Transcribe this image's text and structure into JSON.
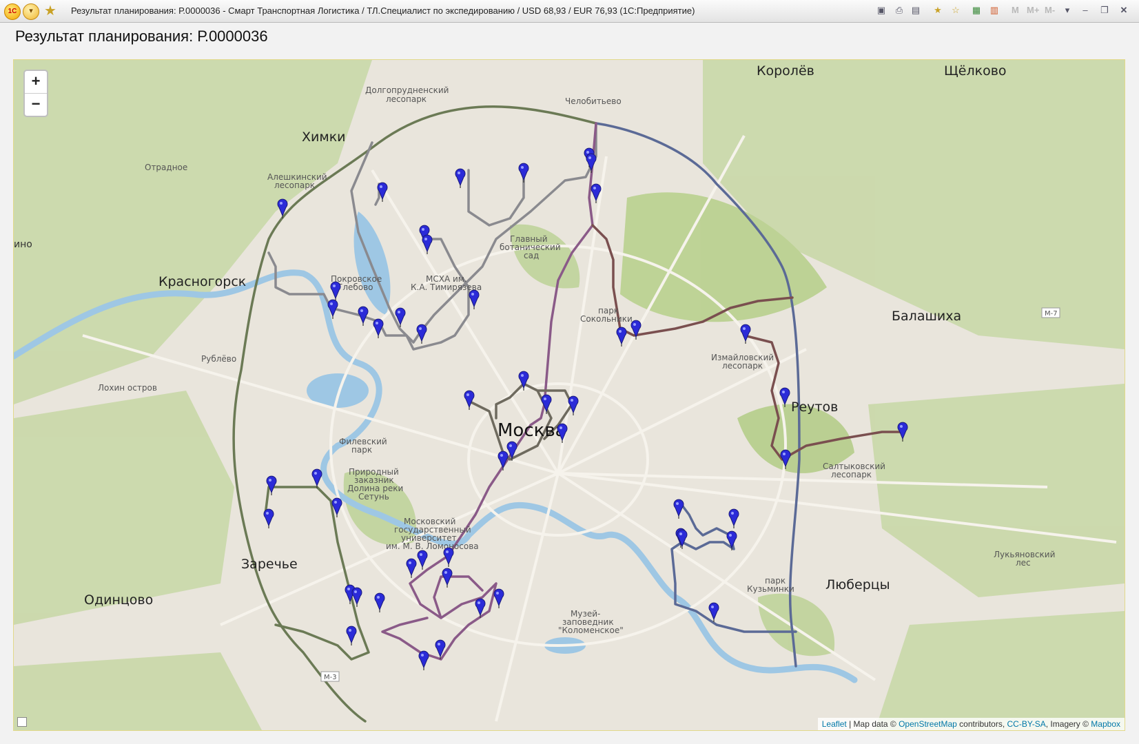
{
  "window": {
    "title": "Результат планирования: Р.0000036 - Смарт Транспортная Логистика / ТЛ.Специалист по экспедированию / USD 68,93 / EUR 76,93  (1С:Предприятие)",
    "logo_text": "1С",
    "toolbar_letters": [
      "M",
      "M+",
      "M-"
    ]
  },
  "page": {
    "title": "Результат планирования: Р.0000036"
  },
  "map": {
    "zoom_in_label": "+",
    "zoom_out_label": "−",
    "attribution": {
      "leaflet": "Leaflet",
      "map_data_prefix": " | Map data © ",
      "osm": "OpenStreetMap",
      "contributors": " contributors, ",
      "license": "CC-BY-SA",
      "imagery_prefix": ", Imagery © ",
      "mapbox": "Mapbox"
    },
    "labels": {
      "korolev": "Королёв",
      "shchelkovo": "Щёлково",
      "chelobitevo": "Челобитьево",
      "dolgoprudny1": "Долгопрудненский",
      "dolgoprudny2": "лесопарк",
      "khimki": "Химки",
      "otradnoe": "Отрадное",
      "aleshkinsky1": "Алешкинский",
      "aleshkinsky2": "лесопарк",
      "imino": "ино",
      "botsad1": "Главный",
      "botsad2": "ботанический",
      "botsad3": "сад",
      "krasnogorsk": "Красногорск",
      "pokrovskoe1": "Покровское",
      "pokrovskoe2": "Глебово",
      "mskha1": "МСХА им.",
      "mskha2": "К.А. Тимирязева",
      "sokolniki1": "парк",
      "sokolniki2": "Сокольники",
      "balashikha": "Балашиха",
      "m7": "М-7",
      "rublevo": "Рублёво",
      "izmaylovo1": "Измайловский",
      "izmaylovo2": "лесопарк",
      "lokhin": "Лохин остров",
      "reutov": "Реутов",
      "moskva": "Москва",
      "filevsky1": "Филевский",
      "filevsky2": "парк",
      "saltykovsky1": "Салтыковский",
      "saltykovsky2": "лесопарк",
      "setun1": "Природный",
      "setun2": "заказник",
      "setun3": "Долина реки",
      "setun4": "Сетунь",
      "mgu1": "Московский",
      "mgu2": "государственный",
      "mgu3": "университет",
      "mgu4": "им. М. В. Ломоносова",
      "lukyanovsky1": "Лукьяновский",
      "lukyanovsky2": "лес",
      "zarechye": "Заречье",
      "kuzminki1": "парк",
      "kuzminki2": "Кузьминки",
      "lyubertsy": "Люберцы",
      "odintsovo": "Одинцово",
      "kolomenskoe1": "Музей-",
      "kolomenskoe2": "заповедник",
      "kolomenskoe3": "\"Коломенское\"",
      "m3": "М-3"
    },
    "route_colors": {
      "ring_green": "#6b7a55",
      "ring_blue": "#5b6a96",
      "purple": "#8a5a88",
      "brown": "#7a4f4f",
      "grey": "#8a8a8f",
      "dark": "#6e6a5e"
    },
    "marker_color": "#2b2bd8",
    "marker_icon": "map-pin-icon"
  }
}
